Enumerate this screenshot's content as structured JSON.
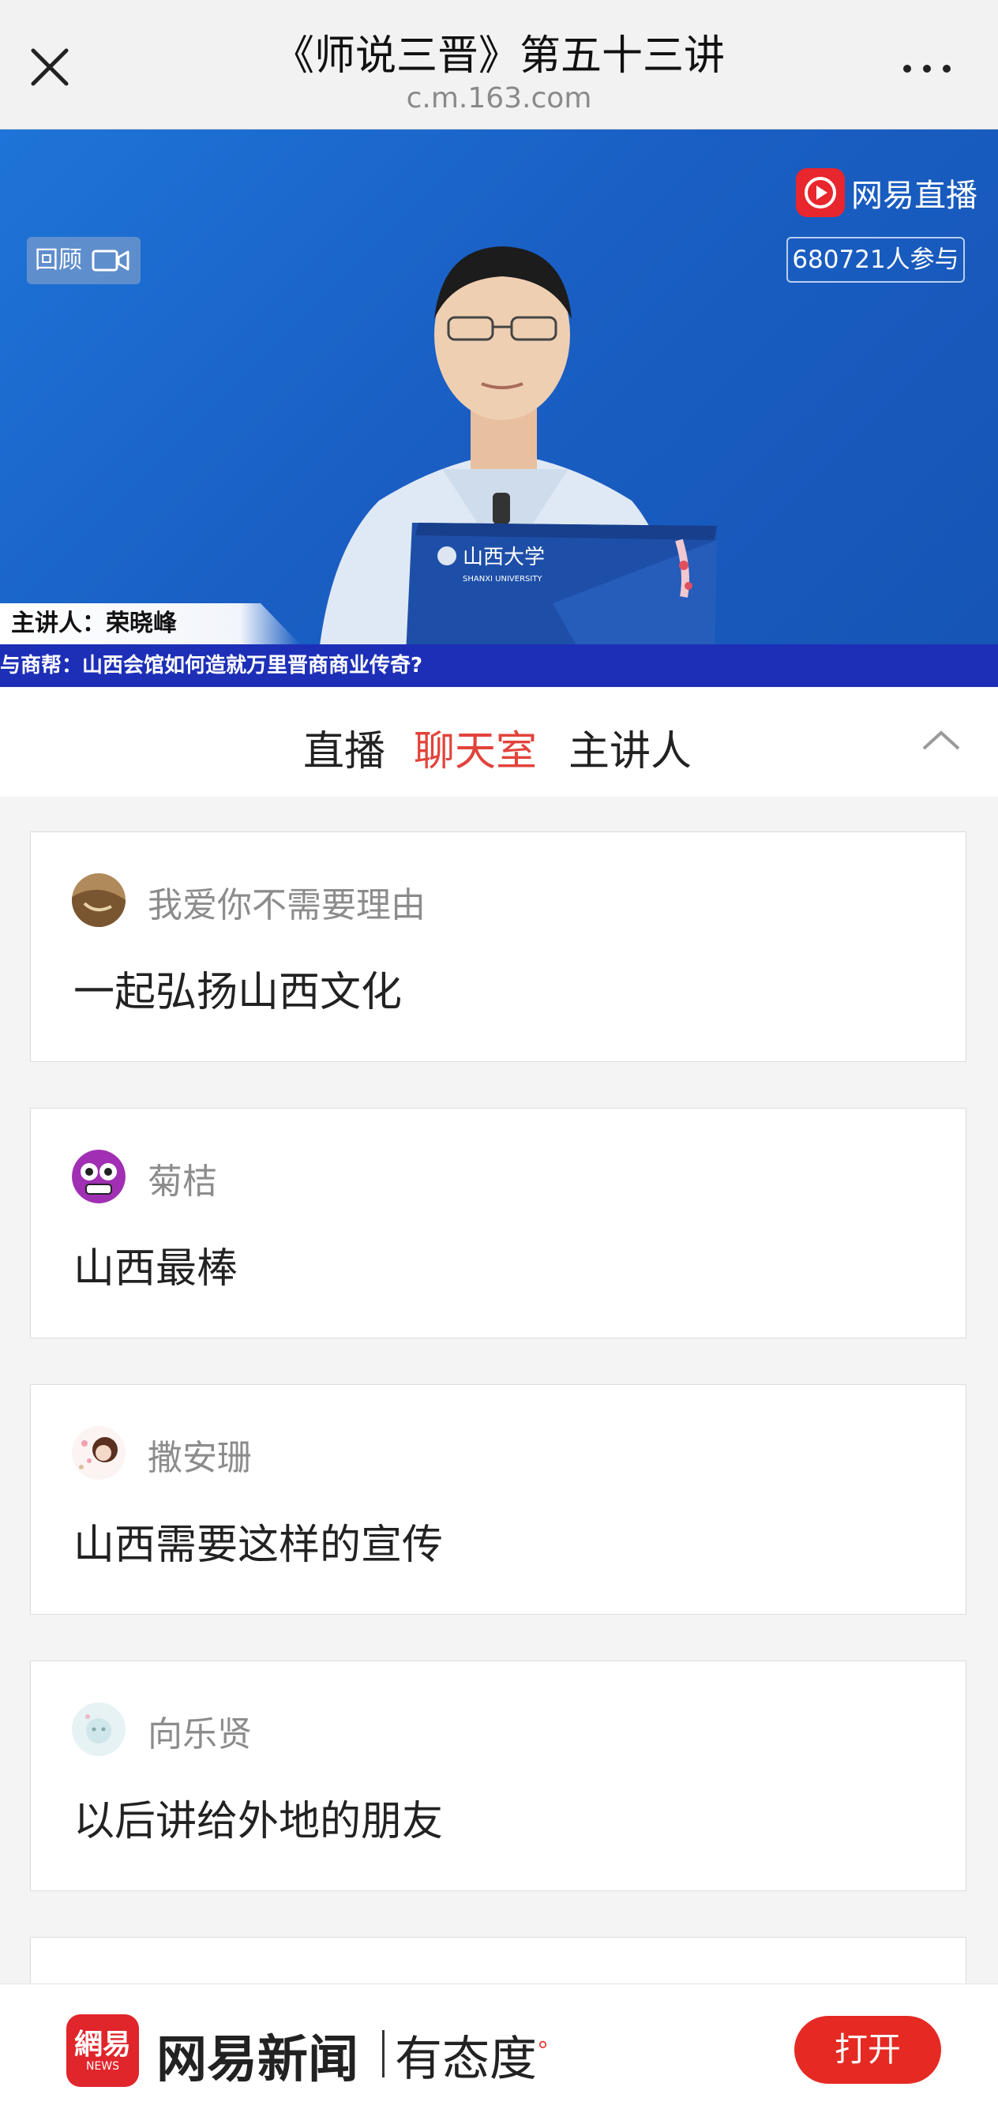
{
  "header": {
    "title": "《师说三晋》第五十三讲",
    "url": "c.m.163.com",
    "close_icon": "close-icon",
    "more_icon": "more-icon"
  },
  "video": {
    "review_label": "回顾",
    "review_icon": "video-camera-icon",
    "brand": "网易直播",
    "participants": "680721人参与",
    "speaker": "主讲人：荣晓峰",
    "ticker": "馆与商帮：山西会馆如何造就万里晋商商业传奇?",
    "podium_label": "山西大学"
  },
  "tabs": {
    "items": [
      "直播",
      "聊天室",
      "主讲人"
    ],
    "active": "聊天室"
  },
  "chat": [
    {
      "user": "我爱你不需要理由",
      "message": "一起弘扬山西文化"
    },
    {
      "user": "菊桔",
      "message": "山西最棒"
    },
    {
      "user": "撒安珊",
      "message": "山西需要这样的宣传"
    },
    {
      "user": "向乐贤",
      "message": "以后讲给外地的朋友"
    }
  ],
  "bottom_bar": {
    "logo_text": "網易",
    "logo_sub": "NEWS",
    "app_name": "网易新闻",
    "slogan": "有态度",
    "open_label": "打开"
  },
  "colors": {
    "accent": "#e2433b",
    "video_blue": "#1a5fc4",
    "ticker_blue": "#1d2fb7"
  }
}
